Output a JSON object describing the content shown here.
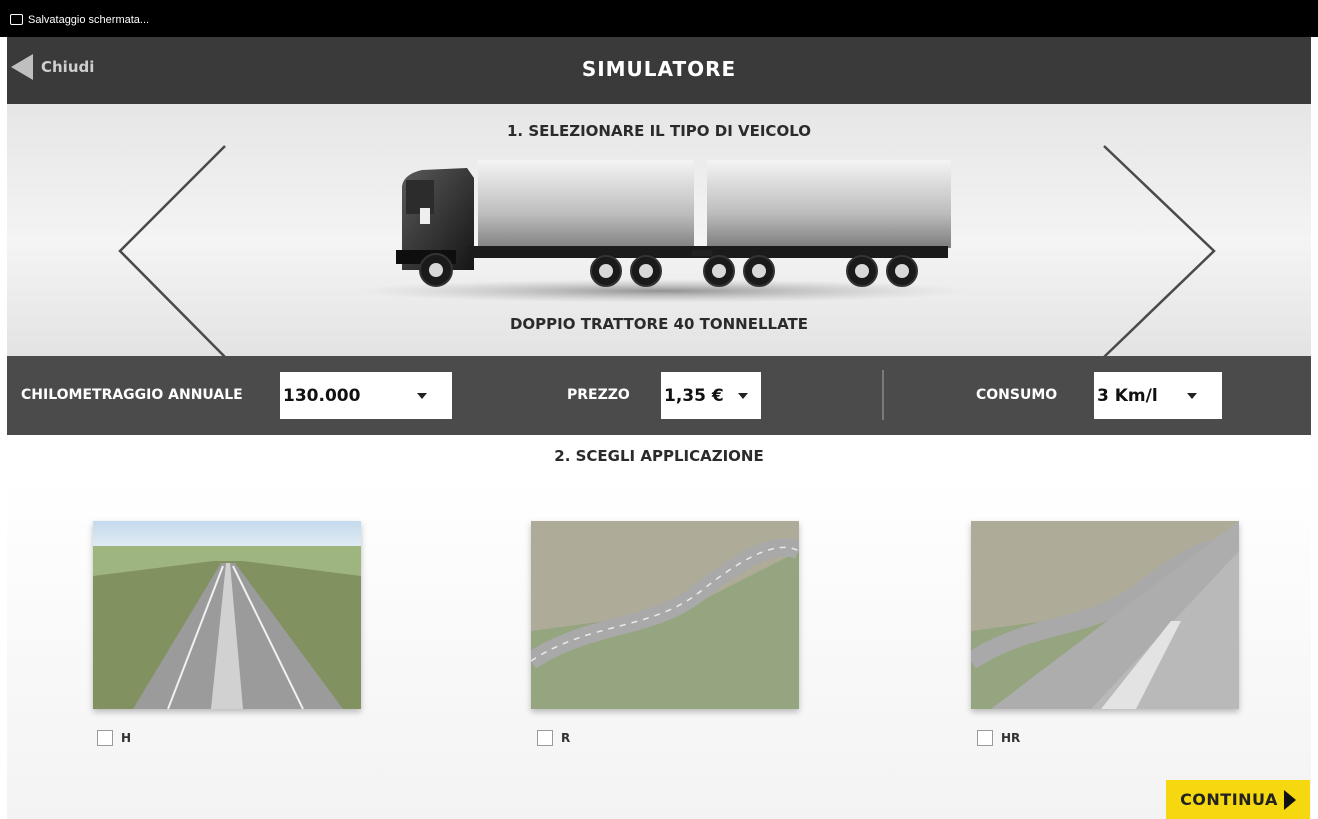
{
  "statusbar": {
    "notification": "Salvataggio schermata..."
  },
  "header": {
    "back_label": "Chiudi",
    "title": "SIMULATORE"
  },
  "vehicle": {
    "step_title": "1. SELEZIONARE IL TIPO DI VEICOLO",
    "name": "DOPPIO TRATTORE 40 TONNELLATE"
  },
  "params": {
    "mileage": {
      "label": "CHILOMETRAGGIO ANNUALE",
      "value": "130.000"
    },
    "price": {
      "label": "PREZZO",
      "value": "1,35 €"
    },
    "consumption": {
      "label": "CONSUMO",
      "value": "3 Km/l"
    }
  },
  "applications": {
    "step_title": "2. SCEGLI APPLICAZIONE",
    "items": [
      {
        "label": "H",
        "checked": false
      },
      {
        "label": "R",
        "checked": false
      },
      {
        "label": "HR",
        "checked": false
      }
    ]
  },
  "continue_label": "CONTINUA",
  "colors": {
    "accent": "#f5d80f",
    "header_bg": "#3a3a3a",
    "params_bg": "#4b4b4b"
  }
}
